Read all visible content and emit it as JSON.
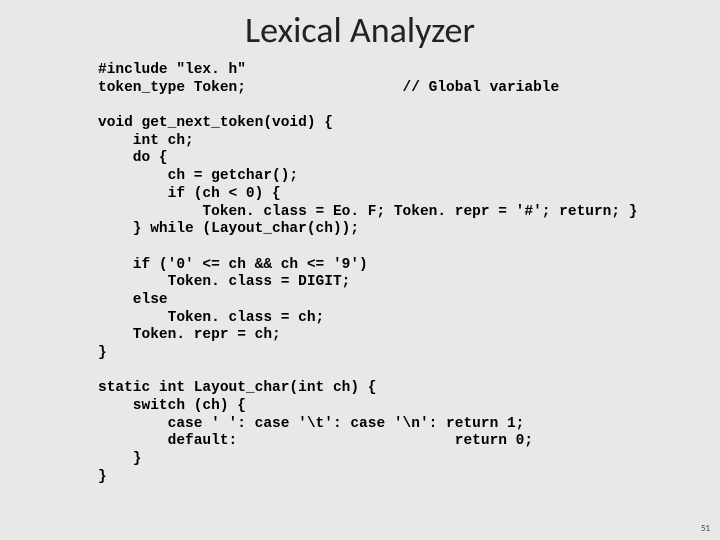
{
  "title": "Lexical Analyzer",
  "code": "#include \"lex. h\"\ntoken_type Token;                  // Global variable\n\nvoid get_next_token(void) {\n    int ch;\n    do {\n        ch = getchar();\n        if (ch < 0) {\n            Token. class = Eo. F; Token. repr = '#'; return; }\n    } while (Layout_char(ch));\n\n    if ('0' <= ch && ch <= '9')\n        Token. class = DIGIT;\n    else\n        Token. class = ch;\n    Token. repr = ch;\n}\n\nstatic int Layout_char(int ch) {\n    switch (ch) {\n        case ' ': case '\\t': case '\\n': return 1;\n        default:                         return 0;\n    }\n}",
  "page_number": "51"
}
